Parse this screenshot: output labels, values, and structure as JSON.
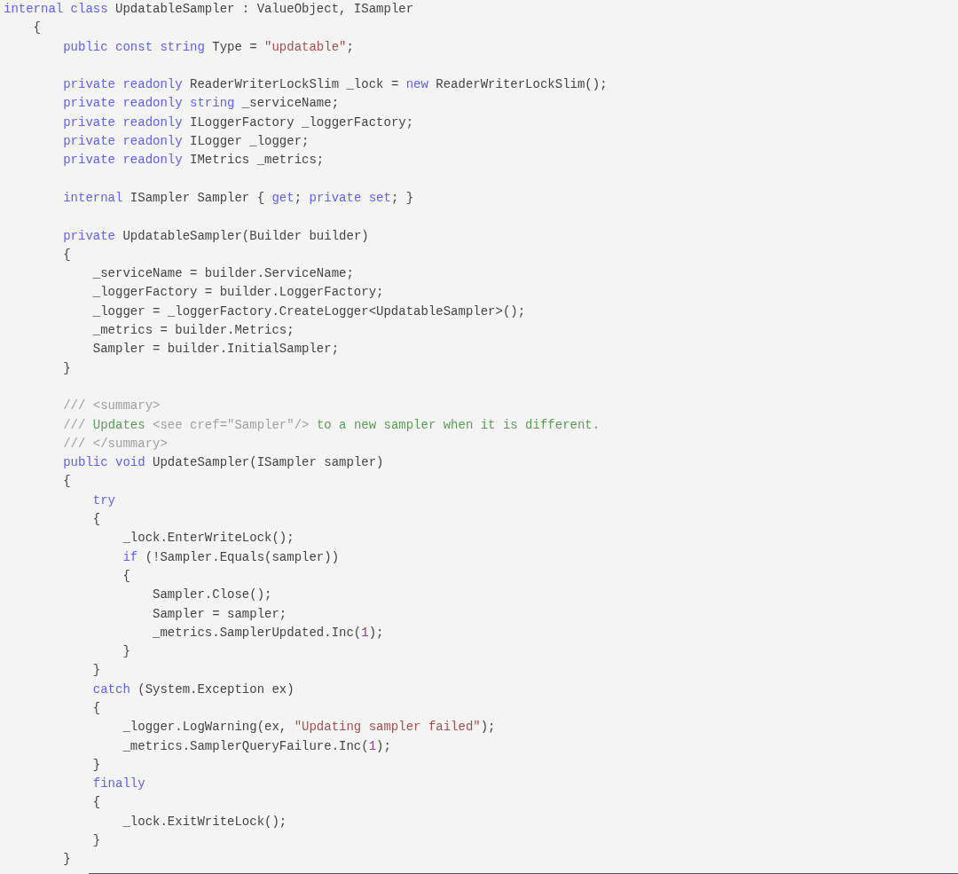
{
  "code_lines": [
    {
      "kind": "code",
      "tokens": [
        {
          "kind": "keyword",
          "text": "internal class"
        },
        {
          "kind": "plain",
          "text": " UpdatableSampler : ValueObject, ISampler"
        }
      ]
    },
    {
      "kind": "code",
      "tokens": [
        {
          "kind": "plain",
          "text": "    {"
        }
      ]
    },
    {
      "kind": "code",
      "tokens": [
        {
          "kind": "keyword",
          "text": "        public const string"
        },
        {
          "kind": "plain",
          "text": " Type = "
        },
        {
          "kind": "string",
          "text": "\"updatable\""
        },
        {
          "kind": "plain",
          "text": ";"
        }
      ]
    },
    {
      "kind": "blank"
    },
    {
      "kind": "code",
      "tokens": [
        {
          "kind": "keyword",
          "text": "        private readonly"
        },
        {
          "kind": "plain",
          "text": " ReaderWriterLockSlim _lock = "
        },
        {
          "kind": "keyword",
          "text": "new"
        },
        {
          "kind": "plain",
          "text": " ReaderWriterLockSlim();"
        }
      ]
    },
    {
      "kind": "code",
      "tokens": [
        {
          "kind": "keyword",
          "text": "        private readonly string"
        },
        {
          "kind": "plain",
          "text": " _serviceName;"
        }
      ]
    },
    {
      "kind": "code",
      "tokens": [
        {
          "kind": "keyword",
          "text": "        private readonly"
        },
        {
          "kind": "plain",
          "text": " ILoggerFactory _loggerFactory;"
        }
      ]
    },
    {
      "kind": "code",
      "tokens": [
        {
          "kind": "keyword",
          "text": "        private readonly"
        },
        {
          "kind": "plain",
          "text": " ILogger _logger;"
        }
      ]
    },
    {
      "kind": "code",
      "tokens": [
        {
          "kind": "keyword",
          "text": "        private readonly"
        },
        {
          "kind": "plain",
          "text": " IMetrics _metrics;"
        }
      ]
    },
    {
      "kind": "blank"
    },
    {
      "kind": "code",
      "tokens": [
        {
          "kind": "keyword",
          "text": "        internal"
        },
        {
          "kind": "plain",
          "text": " ISampler Sampler { "
        },
        {
          "kind": "keyword",
          "text": "get"
        },
        {
          "kind": "plain",
          "text": "; "
        },
        {
          "kind": "keyword",
          "text": "private set"
        },
        {
          "kind": "plain",
          "text": "; }"
        }
      ]
    },
    {
      "kind": "blank"
    },
    {
      "kind": "code",
      "tokens": [
        {
          "kind": "keyword",
          "text": "        private"
        },
        {
          "kind": "plain",
          "text": " UpdatableSampler(Builder builder)"
        }
      ]
    },
    {
      "kind": "code",
      "tokens": [
        {
          "kind": "plain",
          "text": "        {"
        }
      ]
    },
    {
      "kind": "code",
      "tokens": [
        {
          "kind": "plain",
          "text": "            _serviceName = builder.ServiceName;"
        }
      ]
    },
    {
      "kind": "code",
      "tokens": [
        {
          "kind": "plain",
          "text": "            _loggerFactory = builder.LoggerFactory;"
        }
      ]
    },
    {
      "kind": "code",
      "tokens": [
        {
          "kind": "plain",
          "text": "            _logger = _loggerFactory.CreateLogger<UpdatableSampler>();"
        }
      ]
    },
    {
      "kind": "code",
      "tokens": [
        {
          "kind": "plain",
          "text": "            _metrics = builder.Metrics;"
        }
      ]
    },
    {
      "kind": "code",
      "tokens": [
        {
          "kind": "plain",
          "text": "            Sampler = builder.InitialSampler;"
        }
      ]
    },
    {
      "kind": "code",
      "tokens": [
        {
          "kind": "plain",
          "text": "        }"
        }
      ]
    },
    {
      "kind": "blank"
    },
    {
      "kind": "code",
      "tokens": [
        {
          "kind": "comment",
          "text": "        /// <summary>"
        }
      ]
    },
    {
      "kind": "code",
      "tokens": [
        {
          "kind": "comment",
          "text": "        /// "
        },
        {
          "kind": "doc",
          "text": "Updates "
        },
        {
          "kind": "comment",
          "text": "<see cref=\"Sampler\"/>"
        },
        {
          "kind": "doc",
          "text": " to a new sampler when it is different."
        }
      ]
    },
    {
      "kind": "code",
      "tokens": [
        {
          "kind": "comment",
          "text": "        /// </summary>"
        }
      ]
    },
    {
      "kind": "code",
      "tokens": [
        {
          "kind": "keyword",
          "text": "        public void"
        },
        {
          "kind": "plain",
          "text": " UpdateSampler(ISampler sampler)"
        }
      ]
    },
    {
      "kind": "code",
      "tokens": [
        {
          "kind": "plain",
          "text": "        {"
        }
      ]
    },
    {
      "kind": "code",
      "tokens": [
        {
          "kind": "keyword",
          "text": "            try"
        }
      ]
    },
    {
      "kind": "code",
      "tokens": [
        {
          "kind": "plain",
          "text": "            {"
        }
      ]
    },
    {
      "kind": "code",
      "tokens": [
        {
          "kind": "plain",
          "text": "                _lock.EnterWriteLock();"
        }
      ]
    },
    {
      "kind": "code",
      "tokens": [
        {
          "kind": "keyword",
          "text": "                if"
        },
        {
          "kind": "plain",
          "text": " (!Sampler.Equals(sampler))"
        }
      ]
    },
    {
      "kind": "code",
      "tokens": [
        {
          "kind": "plain",
          "text": "                {"
        }
      ]
    },
    {
      "kind": "code",
      "tokens": [
        {
          "kind": "plain",
          "text": "                    Sampler.Close();"
        }
      ]
    },
    {
      "kind": "code",
      "tokens": [
        {
          "kind": "plain",
          "text": "                    Sampler = sampler;"
        }
      ]
    },
    {
      "kind": "code",
      "tokens": [
        {
          "kind": "plain",
          "text": "                    _metrics.SamplerUpdated.Inc("
        },
        {
          "kind": "number",
          "text": "1"
        },
        {
          "kind": "plain",
          "text": ");"
        }
      ]
    },
    {
      "kind": "code",
      "tokens": [
        {
          "kind": "plain",
          "text": "                }"
        }
      ]
    },
    {
      "kind": "code",
      "tokens": [
        {
          "kind": "plain",
          "text": "            }"
        }
      ]
    },
    {
      "kind": "code",
      "tokens": [
        {
          "kind": "keyword",
          "text": "            catch"
        },
        {
          "kind": "plain",
          "text": " (System.Exception ex)"
        }
      ]
    },
    {
      "kind": "code",
      "tokens": [
        {
          "kind": "plain",
          "text": "            {"
        }
      ]
    },
    {
      "kind": "code",
      "tokens": [
        {
          "kind": "plain",
          "text": "                _logger.LogWarning(ex, "
        },
        {
          "kind": "string",
          "text": "\"Updating sampler failed\""
        },
        {
          "kind": "plain",
          "text": ");"
        }
      ]
    },
    {
      "kind": "code",
      "tokens": [
        {
          "kind": "plain",
          "text": "                _metrics.SamplerQueryFailure.Inc("
        },
        {
          "kind": "number",
          "text": "1"
        },
        {
          "kind": "plain",
          "text": ");"
        }
      ]
    },
    {
      "kind": "code",
      "tokens": [
        {
          "kind": "plain",
          "text": "            }"
        }
      ]
    },
    {
      "kind": "code",
      "tokens": [
        {
          "kind": "keyword",
          "text": "            finally"
        }
      ]
    },
    {
      "kind": "code",
      "tokens": [
        {
          "kind": "plain",
          "text": "            {"
        }
      ]
    },
    {
      "kind": "code",
      "tokens": [
        {
          "kind": "plain",
          "text": "                _lock.ExitWriteLock();"
        }
      ]
    },
    {
      "kind": "code",
      "tokens": [
        {
          "kind": "plain",
          "text": "            }"
        }
      ]
    },
    {
      "kind": "code",
      "tokens": [
        {
          "kind": "plain",
          "text": "        }"
        }
      ]
    }
  ]
}
